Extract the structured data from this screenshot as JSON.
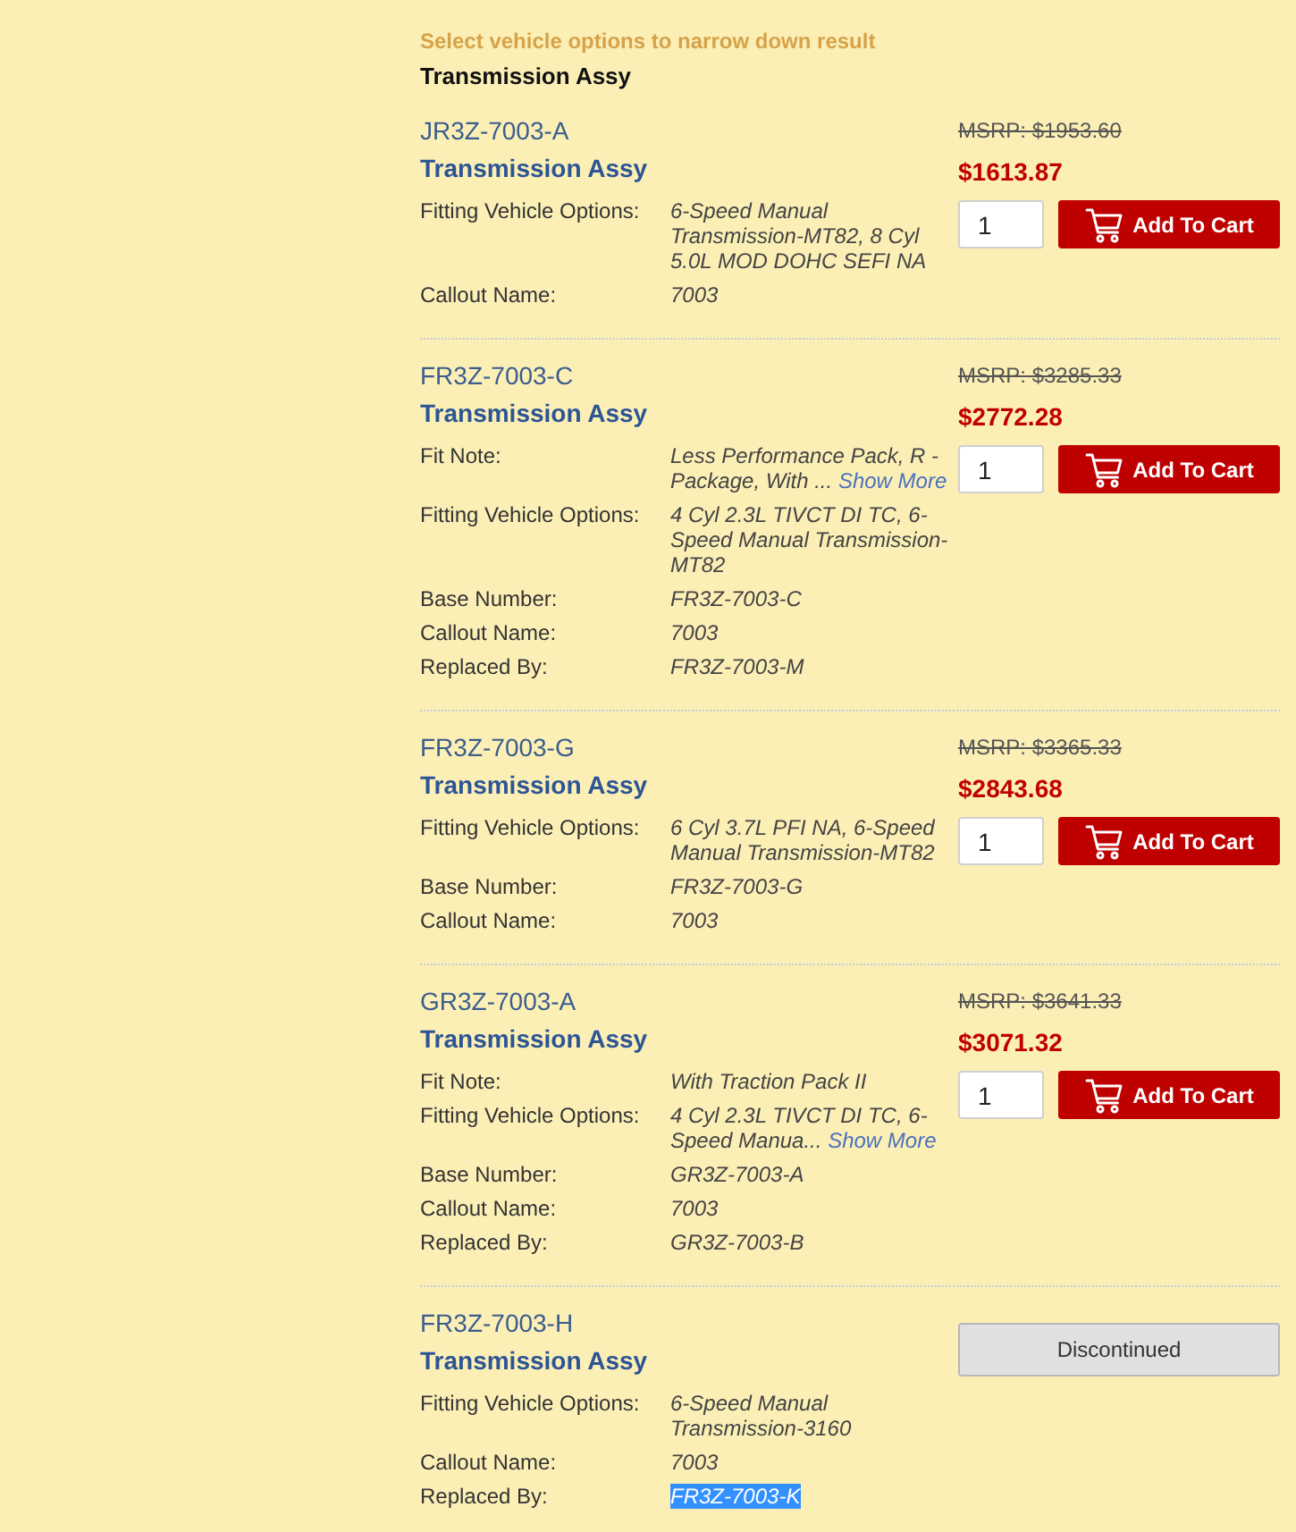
{
  "header": {
    "hint": "Select vehicle options to narrow down result",
    "title": "Transmission Assy"
  },
  "items": [
    {
      "part_number": "JR3Z-7003-A",
      "name": "Transmission Assy",
      "details": [
        {
          "label": "Fitting Vehicle Options:",
          "value": "6-Speed Manual Transmission-MT82, 8 Cyl 5.0L MOD DOHC SEFI NA",
          "highlighted": false
        },
        {
          "label": "Callout Name:",
          "value": "7003",
          "highlighted": false
        }
      ],
      "msrp": "MSRP: $1953.60",
      "price": "$1613.87",
      "action": {
        "kind": "add_to_cart",
        "quantity": "1",
        "label": "Add To Cart"
      }
    },
    {
      "part_number": "FR3Z-7003-C",
      "name": "Transmission Assy",
      "details": [
        {
          "label": "Fit Note:",
          "value": "Less Performance Pack, R - Package, With ...",
          "link": "Show More",
          "highlighted": false
        },
        {
          "label": "Fitting Vehicle Options:",
          "value": "4 Cyl 2.3L TIVCT DI TC, 6-Speed Manual Transmission-MT82",
          "highlighted": false
        },
        {
          "label": "Base Number:",
          "value": "FR3Z-7003-C",
          "highlighted": false
        },
        {
          "label": "Callout Name:",
          "value": "7003",
          "highlighted": false
        },
        {
          "label": "Replaced By:",
          "value": "FR3Z-7003-M",
          "highlighted": false
        }
      ],
      "msrp": "MSRP: $3285.33",
      "price": "$2772.28",
      "action": {
        "kind": "add_to_cart",
        "quantity": "1",
        "label": "Add To Cart"
      }
    },
    {
      "part_number": "FR3Z-7003-G",
      "name": "Transmission Assy",
      "details": [
        {
          "label": "Fitting Vehicle Options:",
          "value": "6 Cyl 3.7L PFI NA, 6-Speed Manual Transmission-MT82",
          "highlighted": false
        },
        {
          "label": "Base Number:",
          "value": "FR3Z-7003-G",
          "highlighted": false
        },
        {
          "label": "Callout Name:",
          "value": "7003",
          "highlighted": false
        }
      ],
      "msrp": "MSRP: $3365.33",
      "price": "$2843.68",
      "action": {
        "kind": "add_to_cart",
        "quantity": "1",
        "label": "Add To Cart"
      }
    },
    {
      "part_number": "GR3Z-7003-A",
      "name": "Transmission Assy",
      "details": [
        {
          "label": "Fit Note:",
          "value": "With Traction Pack II",
          "highlighted": false
        },
        {
          "label": "Fitting Vehicle Options:",
          "value": "4 Cyl 2.3L TIVCT DI TC, 6-Speed Manua...",
          "link": "Show More",
          "highlighted": false
        },
        {
          "label": "Base Number:",
          "value": "GR3Z-7003-A",
          "highlighted": false
        },
        {
          "label": "Callout Name:",
          "value": "7003",
          "highlighted": false
        },
        {
          "label": "Replaced By:",
          "value": "GR3Z-7003-B",
          "highlighted": false
        }
      ],
      "msrp": "MSRP: $3641.33",
      "price": "$3071.32",
      "action": {
        "kind": "add_to_cart",
        "quantity": "1",
        "label": "Add To Cart"
      }
    },
    {
      "part_number": "FR3Z-7003-H",
      "name": "Transmission Assy",
      "details": [
        {
          "label": "Fitting Vehicle Options:",
          "value": "6-Speed Manual Transmission-3160",
          "highlighted": false
        },
        {
          "label": "Callout Name:",
          "value": "7003",
          "highlighted": false
        },
        {
          "label": "Replaced By:",
          "value": "FR3Z-7003-K",
          "highlighted": true
        }
      ],
      "action": {
        "kind": "discontinued",
        "label": "Discontinued"
      }
    }
  ]
}
